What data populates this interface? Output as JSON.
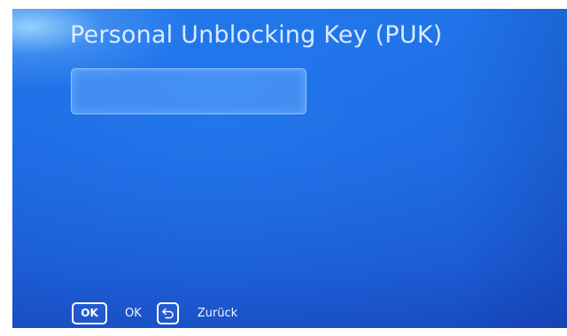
{
  "screen": {
    "title": "Personal Unblocking Key (PUK)",
    "puk_field": {
      "value": "",
      "placeholder": ""
    }
  },
  "footer": {
    "ok_key": {
      "badge_text": "OK",
      "label": "OK"
    },
    "back_key": {
      "icon": "back-arrow-icon",
      "label": "Zurück"
    }
  },
  "colors": {
    "background": "#1c63dc",
    "text": "#ffffff"
  }
}
